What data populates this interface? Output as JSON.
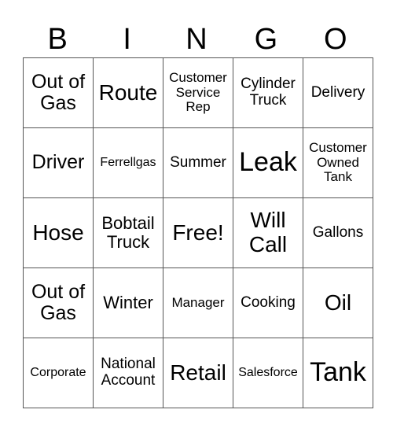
{
  "header": {
    "letters": [
      "B",
      "I",
      "N",
      "G",
      "O"
    ]
  },
  "rows": [
    [
      "Out of Gas",
      "Route",
      "Customer Service Rep",
      "Cylinder Truck",
      "Delivery"
    ],
    [
      "Driver",
      "Ferrellgas",
      "Summer",
      "Leak",
      "Customer Owned Tank"
    ],
    [
      "Hose",
      "Bobtail Truck",
      "Free!",
      "Will Call",
      "Gallons"
    ],
    [
      "Out of Gas",
      "Winter",
      "Manager",
      "Cooking",
      "Oil"
    ],
    [
      "Corporate",
      "National Account",
      "Retail",
      "Salesforce",
      "Tank"
    ]
  ]
}
